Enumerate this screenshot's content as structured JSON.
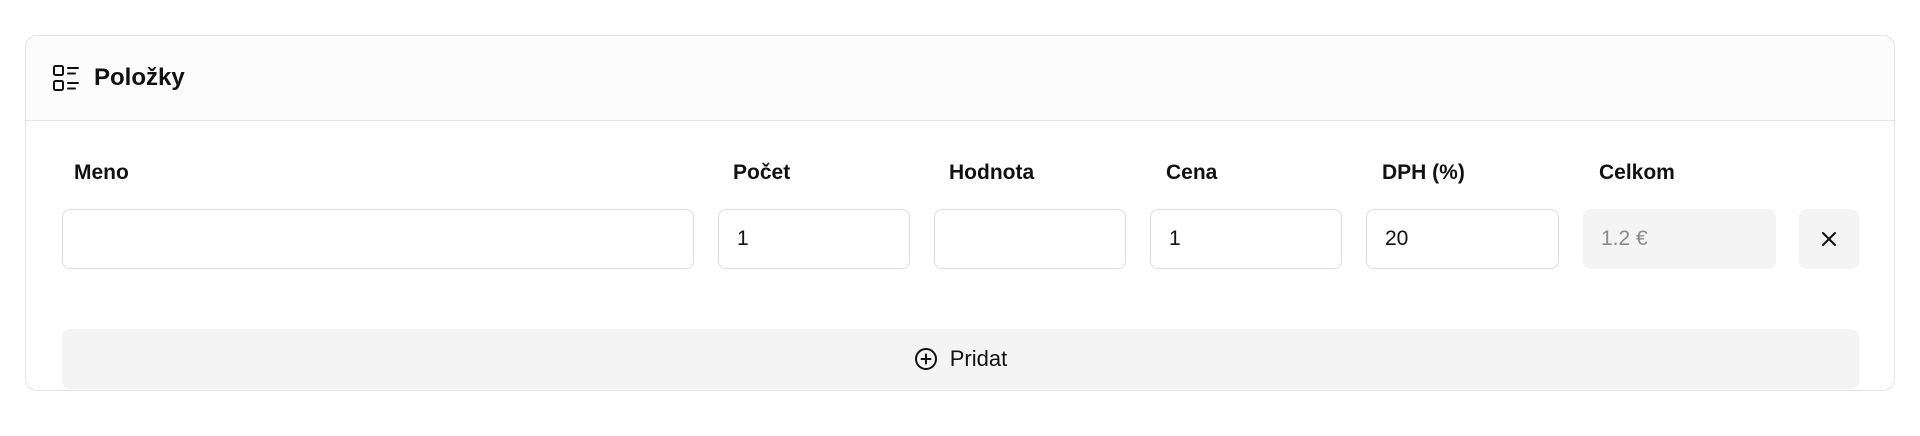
{
  "section": {
    "title": "Položky",
    "icon": "list-details-icon"
  },
  "columns": {
    "name": "Meno",
    "quantity": "Počet",
    "value": "Hodnota",
    "price": "Cena",
    "vat": "DPH (%)",
    "total": "Celkom"
  },
  "row": {
    "name": "",
    "quantity": "1",
    "value": "",
    "price": "1",
    "vat": "20",
    "total": "1.2 €"
  },
  "actions": {
    "add_label": "Pridat",
    "add_icon": "plus-circle-icon",
    "remove_icon": "close-icon"
  }
}
